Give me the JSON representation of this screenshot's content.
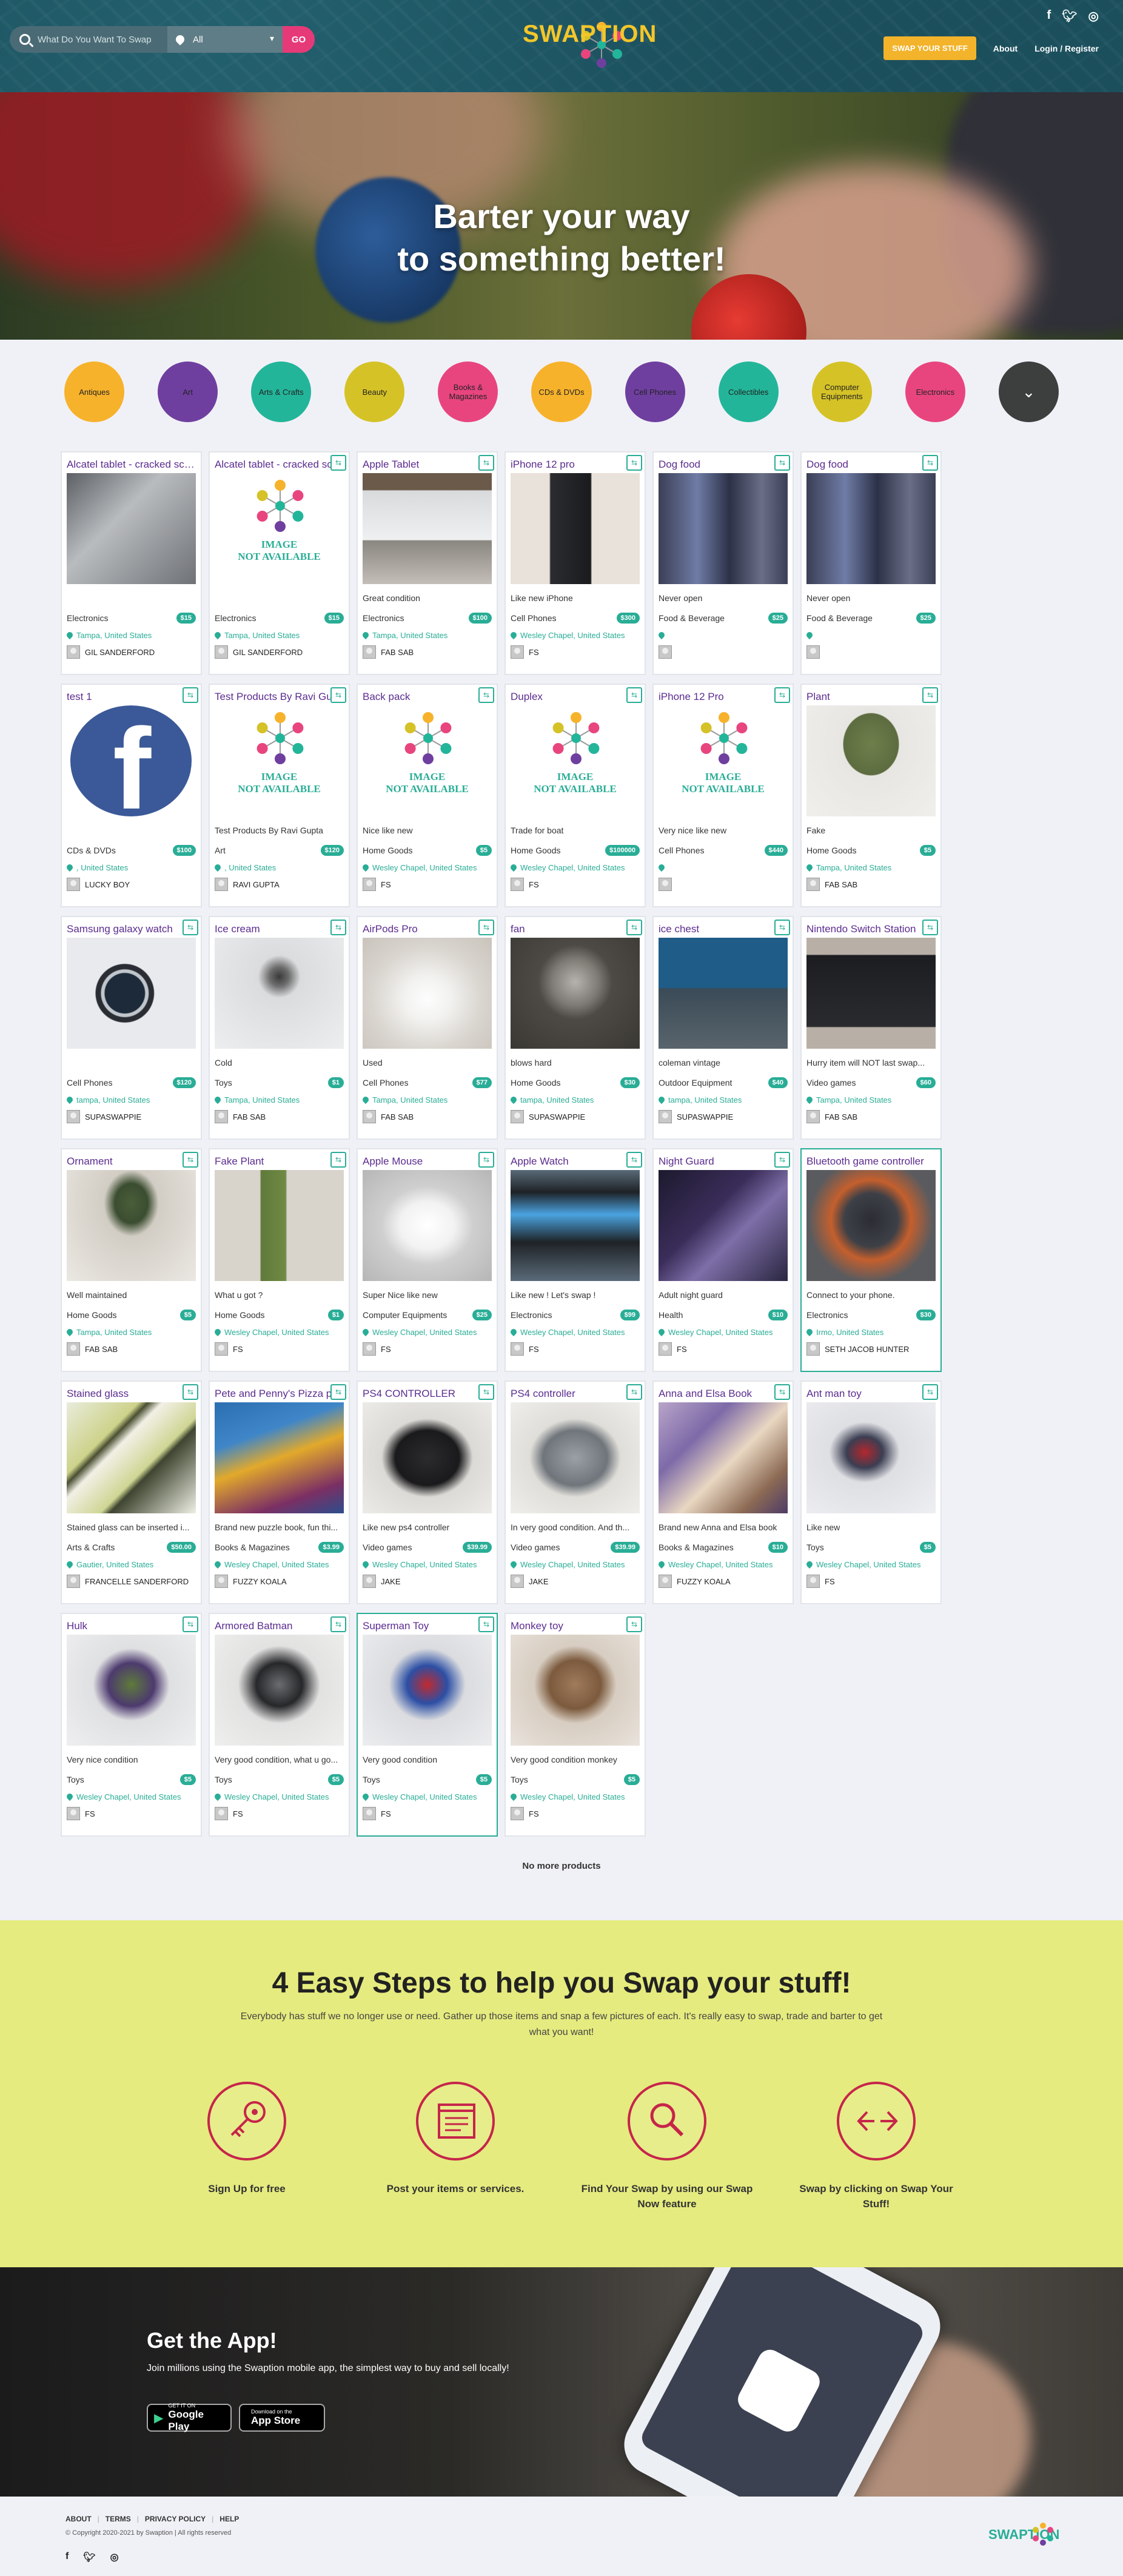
{
  "header": {
    "search_placeholder": "What Do You Want To Swap",
    "location_value": "All",
    "go_label": "GO",
    "logo_text": "SWAPTION",
    "swap_button": "SWAP YOUR STUFF",
    "about": "About",
    "login": "Login / Register",
    "social": [
      "facebook-icon",
      "twitter-icon",
      "instagram-icon"
    ]
  },
  "hero": {
    "line1": "Barter your way",
    "line2": "to something better!"
  },
  "categories": [
    {
      "label": "Antiques",
      "color": "#f7b22b"
    },
    {
      "label": "Art",
      "color": "#6f3fa0"
    },
    {
      "label": "Arts & Crafts",
      "color": "#23b59a"
    },
    {
      "label": "Beauty",
      "color": "#d5c227"
    },
    {
      "label": "Books & Magazines",
      "color": "#e8457f"
    },
    {
      "label": "CDs & DVDs",
      "color": "#f7b22b"
    },
    {
      "label": "Cell Phones",
      "color": "#6f3fa0"
    },
    {
      "label": "Collectibles",
      "color": "#23b59a"
    },
    {
      "label": "Computer Equipments",
      "color": "#d5c227"
    },
    {
      "label": "Electronics",
      "color": "#e8457f"
    }
  ],
  "products": [
    {
      "title": "Alcatel tablet - cracked screen",
      "desc": "",
      "category": "Electronics",
      "price": "$15",
      "location": "Tampa, United States",
      "user": "GIL SANDERFORD",
      "img": "tablet",
      "badge": false
    },
    {
      "title": "Alcatel tablet - cracked screen",
      "desc": "",
      "category": "Electronics",
      "price": "$15",
      "location": "Tampa, United States",
      "user": "GIL SANDERFORD",
      "img": "none",
      "badge": true
    },
    {
      "title": "Apple Tablet",
      "desc": "Great condition",
      "category": "Electronics",
      "price": "$100",
      "location": "Tampa, United States",
      "user": "FAB SAB",
      "img": "laptop",
      "badge": true
    },
    {
      "title": "iPhone 12 pro",
      "desc": "Like new iPhone",
      "category": "Cell Phones",
      "price": "$300",
      "location": "Wesley Chapel, United States",
      "user": "FS",
      "img": "phone",
      "badge": true
    },
    {
      "title": "Dog food",
      "desc": "Never open",
      "category": "Food & Beverage",
      "price": "$25",
      "location": "",
      "user": "",
      "img": "dogfood",
      "badge": true
    },
    {
      "title": "Dog food",
      "desc": "Never open",
      "category": "Food & Beverage",
      "price": "$25",
      "location": "",
      "user": "",
      "img": "dogfood",
      "badge": true
    },
    {
      "title": "test 1",
      "desc": "",
      "category": "CDs & DVDs",
      "price": "$100",
      "location": ", United States",
      "user": "LUCKY BOY",
      "img": "fb",
      "badge": true
    },
    {
      "title": "Test Products By Ravi Gupta",
      "desc": "Test Products By Ravi Gupta",
      "category": "Art",
      "price": "$120",
      "location": ", United States",
      "user": "RAVI GUPTA",
      "img": "none",
      "badge": true
    },
    {
      "title": "Back pack",
      "desc": "Nice like new",
      "category": "Home Goods",
      "price": "$5",
      "location": "Wesley Chapel, United States",
      "user": "FS",
      "img": "none",
      "badge": true
    },
    {
      "title": "Duplex",
      "desc": "Trade for boat",
      "category": "Home Goods",
      "price": "$100000",
      "location": "Wesley Chapel, United States",
      "user": "FS",
      "img": "none",
      "badge": true
    },
    {
      "title": "iPhone 12 Pro",
      "desc": "Very nice like new",
      "category": "Cell Phones",
      "price": "$440",
      "location": "",
      "user": "",
      "img": "none",
      "badge": true
    },
    {
      "title": "Plant",
      "desc": "Fake",
      "category": "Home Goods",
      "price": "$5",
      "location": "Tampa, United States",
      "user": "FAB SAB",
      "img": "plant",
      "badge": true
    },
    {
      "title": "Samsung galaxy watch",
      "desc": "",
      "category": "Cell Phones",
      "price": "$120",
      "location": "tampa, United States",
      "user": "SUPASWAPPIE",
      "img": "watch",
      "badge": true
    },
    {
      "title": "Ice cream",
      "desc": "Cold",
      "category": "Toys",
      "price": "$1",
      "location": "Tampa, United States",
      "user": "FAB SAB",
      "img": "icecream",
      "badge": true
    },
    {
      "title": "AirPods Pro",
      "desc": "Used",
      "category": "Cell Phones",
      "price": "$77",
      "location": "Tampa, United States",
      "user": "FAB SAB",
      "img": "airpods",
      "badge": true
    },
    {
      "title": "fan",
      "desc": "blows hard",
      "category": "Home Goods",
      "price": "$30",
      "location": "tampa, United States",
      "user": "SUPASWAPPIE",
      "img": "fan",
      "badge": true
    },
    {
      "title": "ice chest",
      "desc": "coleman vintage",
      "category": "Outdoor Equipment",
      "price": "$40",
      "location": "tampa, United States",
      "user": "SUPASWAPPIE",
      "img": "icechest",
      "badge": true
    },
    {
      "title": "Nintendo Switch Station",
      "desc": "Hurry item will NOT last swap...",
      "category": "Video games",
      "price": "$60",
      "location": "Tampa, United States",
      "user": "FAB SAB",
      "img": "switch",
      "badge": true
    },
    {
      "title": "Ornament",
      "desc": "Well maintained",
      "category": "Home Goods",
      "price": "$5",
      "location": "Tampa, United States",
      "user": "FAB SAB",
      "img": "succulent",
      "badge": true
    },
    {
      "title": "Fake Plant",
      "desc": "What u got ?",
      "category": "Home Goods",
      "price": "$1",
      "location": "Wesley Chapel, United States",
      "user": "FS",
      "img": "cactus",
      "badge": true
    },
    {
      "title": "Apple Mouse",
      "desc": "Super Nice like new",
      "category": "Computer Equipments",
      "price": "$25",
      "location": "Wesley Chapel, United States",
      "user": "FS",
      "img": "mouse",
      "badge": true
    },
    {
      "title": "Apple Watch",
      "desc": "Like new ! Let's swap !",
      "category": "Electronics",
      "price": "$99",
      "location": "Wesley Chapel, United States",
      "user": "FS",
      "img": "applewatch",
      "badge": true
    },
    {
      "title": "Night Guard",
      "desc": "Adult night guard",
      "category": "Health",
      "price": "$10",
      "location": "Wesley Chapel, United States",
      "user": "FS",
      "img": "nightguard",
      "badge": true
    },
    {
      "title": "Bluetooth game controller",
      "desc": "Connect to your phone.",
      "category": "Electronics",
      "price": "$30",
      "location": "Irmo, United States",
      "user": "SETH JACOB HUNTER",
      "img": "btcontroller",
      "badge": false,
      "hl": true
    },
    {
      "title": "Stained glass",
      "desc": "Stained glass can be inserted i...",
      "category": "Arts & Crafts",
      "price": "$50.00",
      "location": "Gautier, United States",
      "user": "FRANCELLE SANDERFORD",
      "img": "stainedglass",
      "badge": true
    },
    {
      "title": "Pete and Penny's Pizza puzzle",
      "desc": "Brand new puzzle book, fun thi...",
      "category": "Books & Magazines",
      "price": "$3.99",
      "location": "Wesley Chapel, United States",
      "user": "FUZZY KOALA",
      "img": "pizzabook",
      "badge": true
    },
    {
      "title": "PS4 CONTROLLER",
      "desc": "Like new ps4 controller",
      "category": "Video games",
      "price": "$39.99",
      "location": "Wesley Chapel, United States",
      "user": "JAKE",
      "img": "ps4black",
      "badge": true
    },
    {
      "title": "PS4 controller",
      "desc": "In very good condition. And th...",
      "category": "Video games",
      "price": "$39.99",
      "location": "Wesley Chapel, United States",
      "user": "JAKE",
      "img": "ps4silver",
      "badge": true
    },
    {
      "title": "Anna and Elsa Book",
      "desc": "Brand new Anna and Elsa book",
      "category": "Books & Magazines",
      "price": "$10",
      "location": "Wesley Chapel, United States",
      "user": "FUZZY KOALA",
      "img": "annabook",
      "badge": true
    },
    {
      "title": "Ant man toy",
      "desc": "Like new",
      "category": "Toys",
      "price": "$5",
      "location": "Wesley Chapel, United States",
      "user": "FS",
      "img": "antman",
      "badge": true
    },
    {
      "title": "Hulk",
      "desc": "Very nice condition",
      "category": "Toys",
      "price": "$5",
      "location": "Wesley Chapel, United States",
      "user": "FS",
      "img": "hulk",
      "badge": true
    },
    {
      "title": "Armored Batman",
      "desc": "Very good condition, what u go...",
      "category": "Toys",
      "price": "$5",
      "location": "Wesley Chapel, United States",
      "user": "FS",
      "img": "batman",
      "badge": true
    },
    {
      "title": "Superman Toy",
      "desc": "Very good condition",
      "category": "Toys",
      "price": "$5",
      "location": "Wesley Chapel, United States",
      "user": "FS",
      "img": "superman",
      "badge": true,
      "hl": true
    },
    {
      "title": "Monkey toy",
      "desc": "Very good condition monkey",
      "category": "Toys",
      "price": "$5",
      "location": "Wesley Chapel, United States",
      "user": "FS",
      "img": "monkey",
      "badge": true
    }
  ],
  "no_image_text": [
    "IMAGE",
    "NOT AVAILABLE"
  ],
  "no_more": "No more products",
  "steps": {
    "title": "4 Easy Steps to help you Swap your stuff!",
    "subtitle": "Everybody has stuff we no longer use or need. Gather up those items and snap a few pictures of each. It's really easy to swap, trade and barter to get what you want!",
    "items": [
      {
        "label": "Sign Up for free",
        "icon": "key-icon"
      },
      {
        "label": "Post your items or services.",
        "icon": "browser-post-icon"
      },
      {
        "label": "Find Your Swap by using our Swap Now feature",
        "icon": "search-icon"
      },
      {
        "label": "Swap by clicking on Swap Your Stuff!",
        "icon": "swap-arrows-icon"
      }
    ]
  },
  "app": {
    "title": "Get the App!",
    "text": "Join millions using the Swaption mobile app, the simplest way to buy and sell locally!",
    "google_small": "GET IT ON",
    "google_big": "Google Play",
    "apple_small": "Download on the",
    "apple_big": "App Store"
  },
  "footer": {
    "links": [
      "ABOUT",
      "TERMS",
      "PRIVACY POLICY",
      "HELP"
    ],
    "copyright": "© Copyright 2020-2021 by Swaption | All rights reserved"
  },
  "colors": {
    "accent": "#29ad96",
    "title": "#5b2c8f",
    "go": "#e63a78",
    "swap_btn": "#f3b32a"
  }
}
